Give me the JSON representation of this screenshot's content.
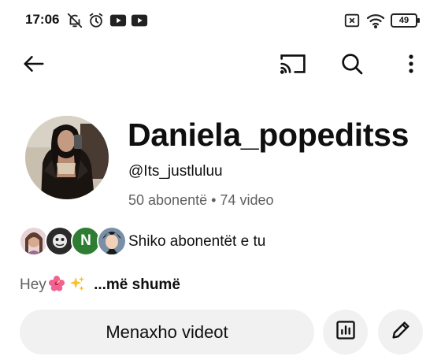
{
  "status_bar": {
    "time": "17:06",
    "battery": "49",
    "icons": [
      "bell-off-icon",
      "alarm-icon",
      "youtube-icon",
      "youtube-icon",
      "sim-off-icon",
      "wifi-icon",
      "battery-icon"
    ]
  },
  "app_bar": {
    "icons": [
      "back-arrow-icon",
      "cast-icon",
      "search-icon",
      "more-vertical-icon"
    ]
  },
  "channel": {
    "name": "Daniela_popeditss",
    "handle": "@Its_justluluu",
    "subscribers": "50 abonentë",
    "separator": "•",
    "videos": "74 video"
  },
  "subscribers_row": {
    "avatars": [
      "subscriber-avatar-1",
      "subscriber-avatar-2",
      "subscriber-avatar-n",
      "subscriber-avatar-4"
    ],
    "letter_avatar": "N",
    "label": "Shiko abonentët e tu"
  },
  "description": {
    "lead": "Hey",
    "emojis": [
      "hibiscus-icon",
      "sparkles-icon"
    ],
    "more": "...më shumë"
  },
  "actions": {
    "manage_videos": "Menaxho videot",
    "icons": [
      "analytics-icon",
      "edit-pencil-icon"
    ]
  },
  "colors": {
    "text_primary": "#0f0f0f",
    "text_secondary": "#606060",
    "button_bg": "#f1f1f1",
    "letter_avatar_bg": "#2e7d32"
  }
}
